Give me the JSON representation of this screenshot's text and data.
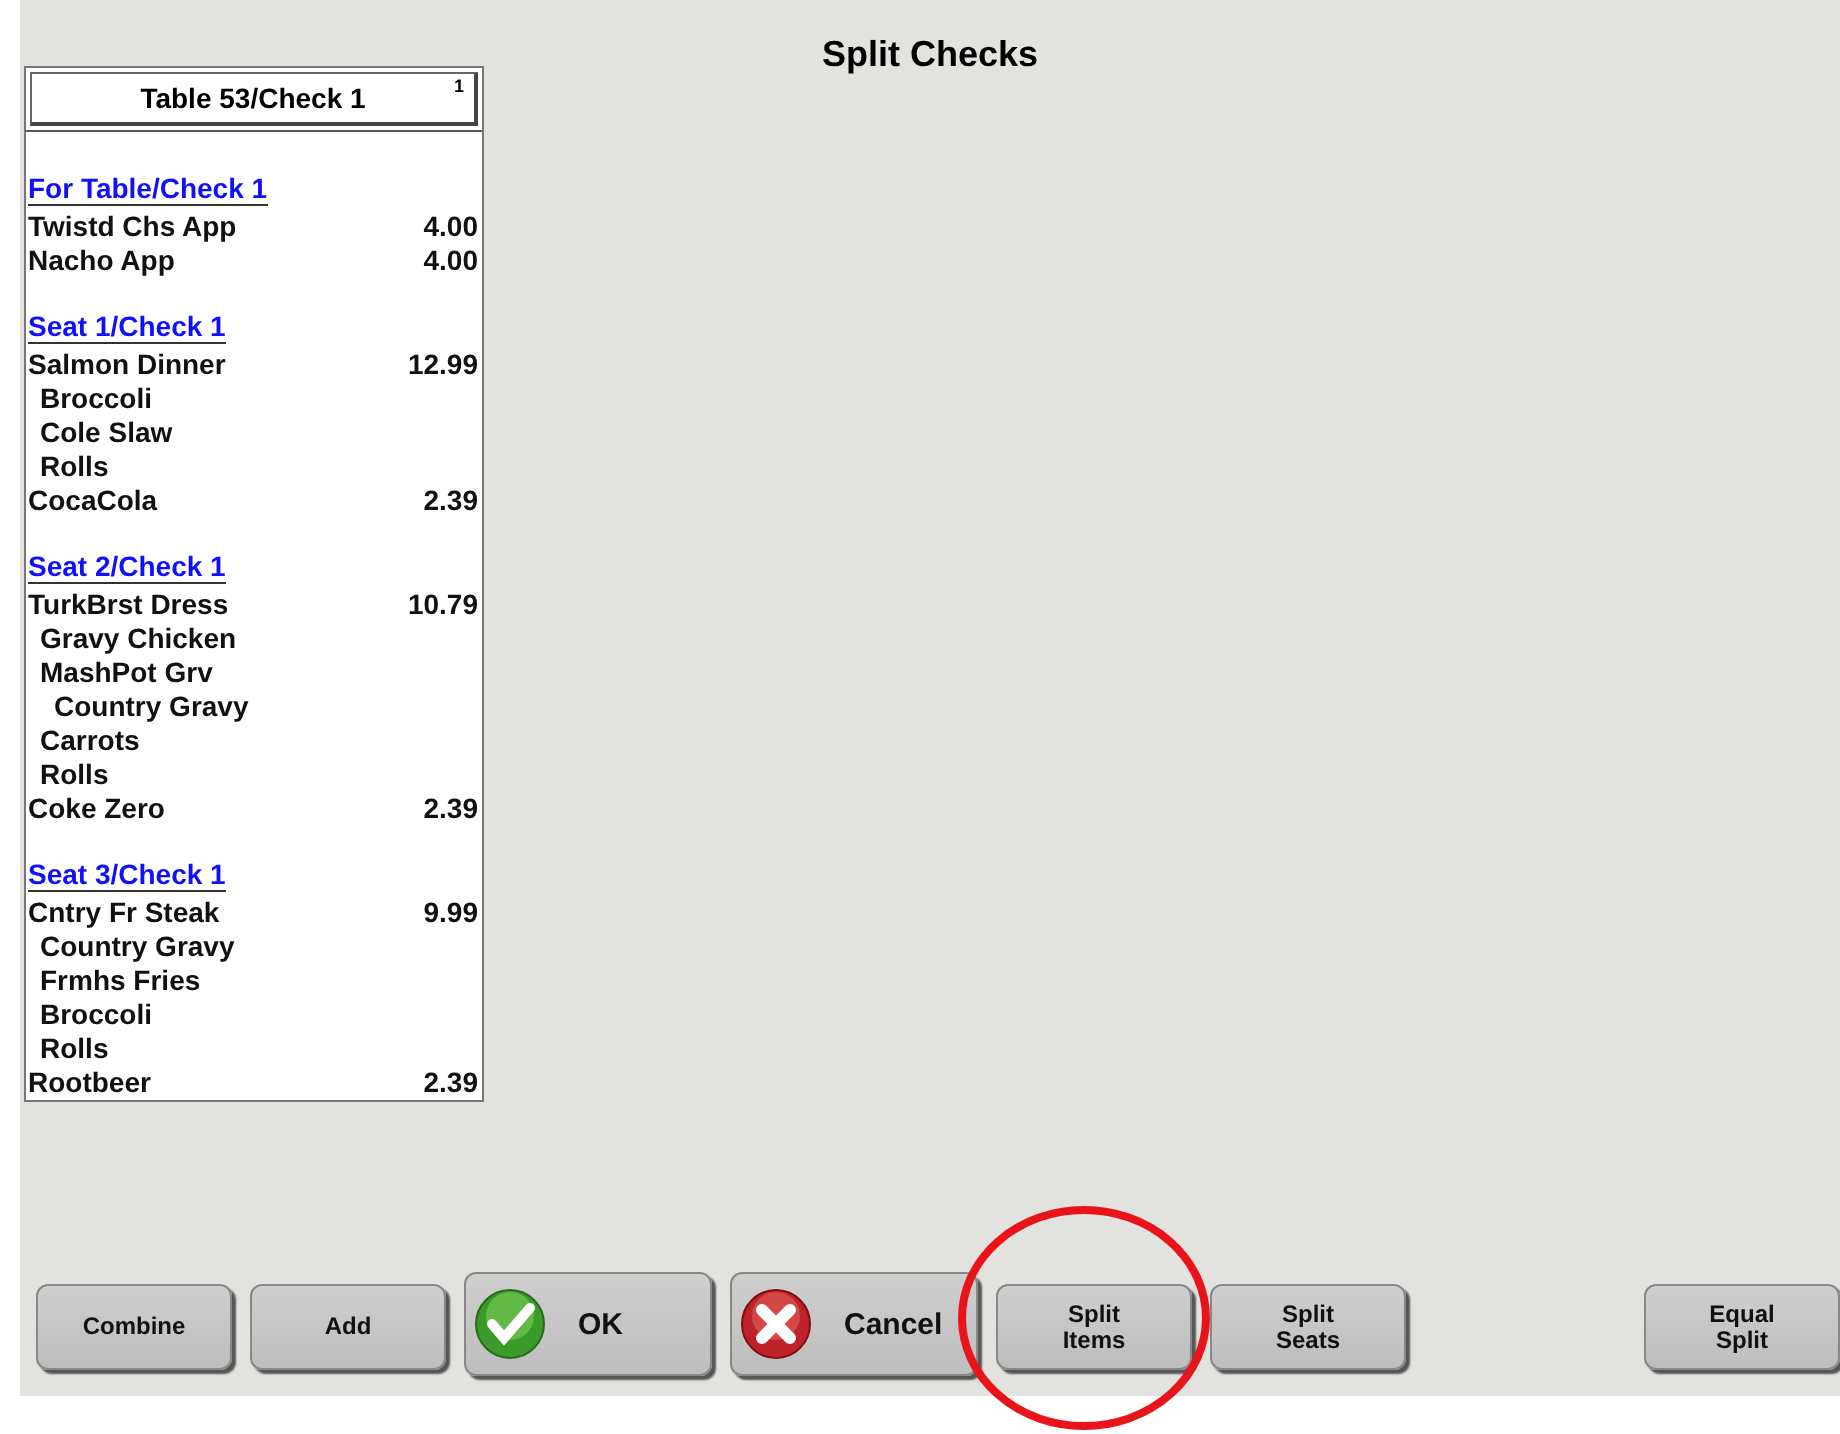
{
  "window": {
    "title": "Split Checks"
  },
  "check": {
    "title": "Table 53/Check 1",
    "corner": "1",
    "sections": [
      {
        "heading": "For Table/Check 1",
        "items": [
          {
            "name": "Twistd Chs App",
            "price": "4.00"
          },
          {
            "name": "Nacho App",
            "price": "4.00"
          }
        ]
      },
      {
        "heading": "Seat 1/Check 1",
        "items": [
          {
            "name": "Salmon Dinner",
            "price": "12.99",
            "children": [
              {
                "name": "Broccoli"
              },
              {
                "name": "Cole Slaw"
              },
              {
                "name": "Rolls"
              }
            ]
          },
          {
            "name": "CocaCola",
            "price": "2.39"
          }
        ]
      },
      {
        "heading": "Seat 2/Check 1",
        "items": [
          {
            "name": "TurkBrst Dress",
            "price": "10.79",
            "children": [
              {
                "name": "Gravy Chicken"
              },
              {
                "name": "MashPot Grv",
                "children": [
                  {
                    "name": "Country Gravy"
                  }
                ]
              },
              {
                "name": "Carrots"
              },
              {
                "name": "Rolls"
              }
            ]
          },
          {
            "name": "Coke Zero",
            "price": "2.39"
          }
        ]
      },
      {
        "heading": "Seat 3/Check 1",
        "items": [
          {
            "name": "Cntry Fr Steak",
            "price": "9.99",
            "children": [
              {
                "name": "Country Gravy"
              },
              {
                "name": "Frmhs Fries"
              },
              {
                "name": "Broccoli"
              },
              {
                "name": "Rolls"
              }
            ]
          },
          {
            "name": "Rootbeer",
            "price": "2.39"
          }
        ]
      }
    ]
  },
  "buttons": [
    {
      "kind": "plain",
      "label": "Combine"
    },
    {
      "kind": "plain",
      "label": "Add"
    },
    {
      "kind": "confirm",
      "label": "OK"
    },
    {
      "kind": "cancel",
      "label": "Cancel"
    },
    {
      "kind": "plain",
      "label": "Split\nItems"
    },
    {
      "kind": "plain",
      "label": "Split\nSeats"
    },
    {
      "kind": "spacer"
    },
    {
      "kind": "plain",
      "label": "Equal\nSplit"
    }
  ]
}
